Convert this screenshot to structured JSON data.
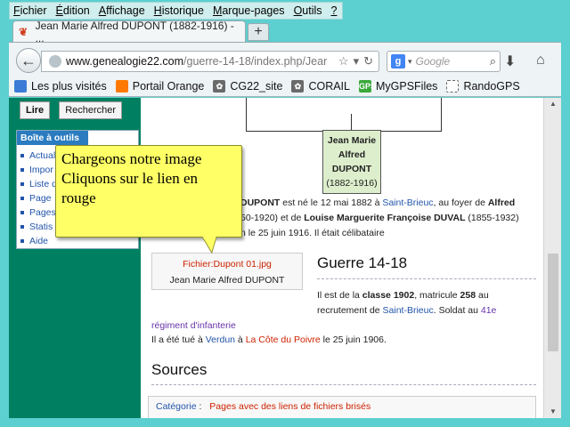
{
  "menu": {
    "items": [
      "Fichier",
      "Édition",
      "Affichage",
      "Historique",
      "Marque-pages",
      "Outils",
      "?"
    ],
    "underline": [
      "F",
      "É",
      "A",
      "H",
      "M",
      "O",
      "?"
    ]
  },
  "tab": {
    "title": "Jean Marie Alfred DUPONT (1882-1916) - ...",
    "new_tab_label": "+"
  },
  "navbar": {
    "url_host": "www.genealogie22.com",
    "url_path": "/guerre-14-18/index.php/Jear",
    "search_engine": "Google",
    "search_placeholder": "Google"
  },
  "bookmarks": [
    {
      "label": "Les plus visités",
      "icon": "bookmark-folder-icon",
      "color": "#3a7bd5"
    },
    {
      "label": "Portail Orange",
      "icon": "orange-icon",
      "color": "#ff7900"
    },
    {
      "label": "CG22_site",
      "icon": "cg22-icon",
      "color": "#6a6a6a"
    },
    {
      "label": "CORAIL",
      "icon": "corail-icon",
      "color": "#6a6a6a"
    },
    {
      "label": "MyGPSFiles",
      "icon": "mygps-icon",
      "color": "#3aa83a"
    },
    {
      "label": "RandoGPS",
      "icon": "blank-page-icon",
      "color": "#ffffff"
    }
  ],
  "sidebar": {
    "search_go": "Lire",
    "search_button": "Rechercher",
    "toolbox_title": "Boîte à outils",
    "toolbox_items": [
      "Actual",
      "Impor",
      "Liste d",
      "Page",
      "Pages",
      "Statis",
      "Aide"
    ]
  },
  "person": {
    "name_line1": "Jean Marie",
    "name_line2": "Alfred",
    "name_line3": "DUPONT",
    "dates": "(1882-1916)"
  },
  "bio": {
    "l1_a": "DUPONT",
    "l1_b": " est né le 12 mai 1882 à ",
    "l1_link": "Saint-Brieuc",
    "l1_c": ", au foyer de ",
    "l1_d": "Alfred",
    "l2_a": "50-1920) et de ",
    "l2_b": "Louise Marguerite Françoise DUVAL",
    "l2_c": " (1855-1932)",
    "l3": "n le 25 juin 1916. Il était célibataire"
  },
  "thumb": {
    "file_link": "Fichier:Dupont 01.jpg",
    "caption": "Jean Marie Alfred DUPONT"
  },
  "section_war": {
    "title": "Guerre 14-18",
    "l1_a": "Il est de la ",
    "l1_b": "classe 1902",
    "l1_c": ", matricule ",
    "l1_d": "258",
    "l1_e": " au",
    "l2_a": "recrutement de ",
    "l2_link": "Saint-Brieuc",
    "l2_b": ". Soldat au ",
    "l2_link2": "41e",
    "l3_link": "régiment d'infanterie",
    "l4_a": "Il a été tué à ",
    "l4_link1": "Verdun",
    "l4_b": " à ",
    "l4_link2": "La Côte du Poivre",
    "l4_c": " le 25 juin 1906."
  },
  "sources": {
    "title": "Sources"
  },
  "category": {
    "label": "Catégorie",
    "sep": ":",
    "link": "Pages avec des liens de fichiers brisés"
  },
  "callout": {
    "line1": "Chargeons notre image",
    "line2": "Cliquons sur le lien en",
    "line3": "rouge"
  },
  "colors": {
    "desktop": "#3cc6c4",
    "sidebar": "#008060",
    "callout": "#ffff66",
    "link_blue": "#2255aa",
    "link_red": "#cc2200"
  }
}
